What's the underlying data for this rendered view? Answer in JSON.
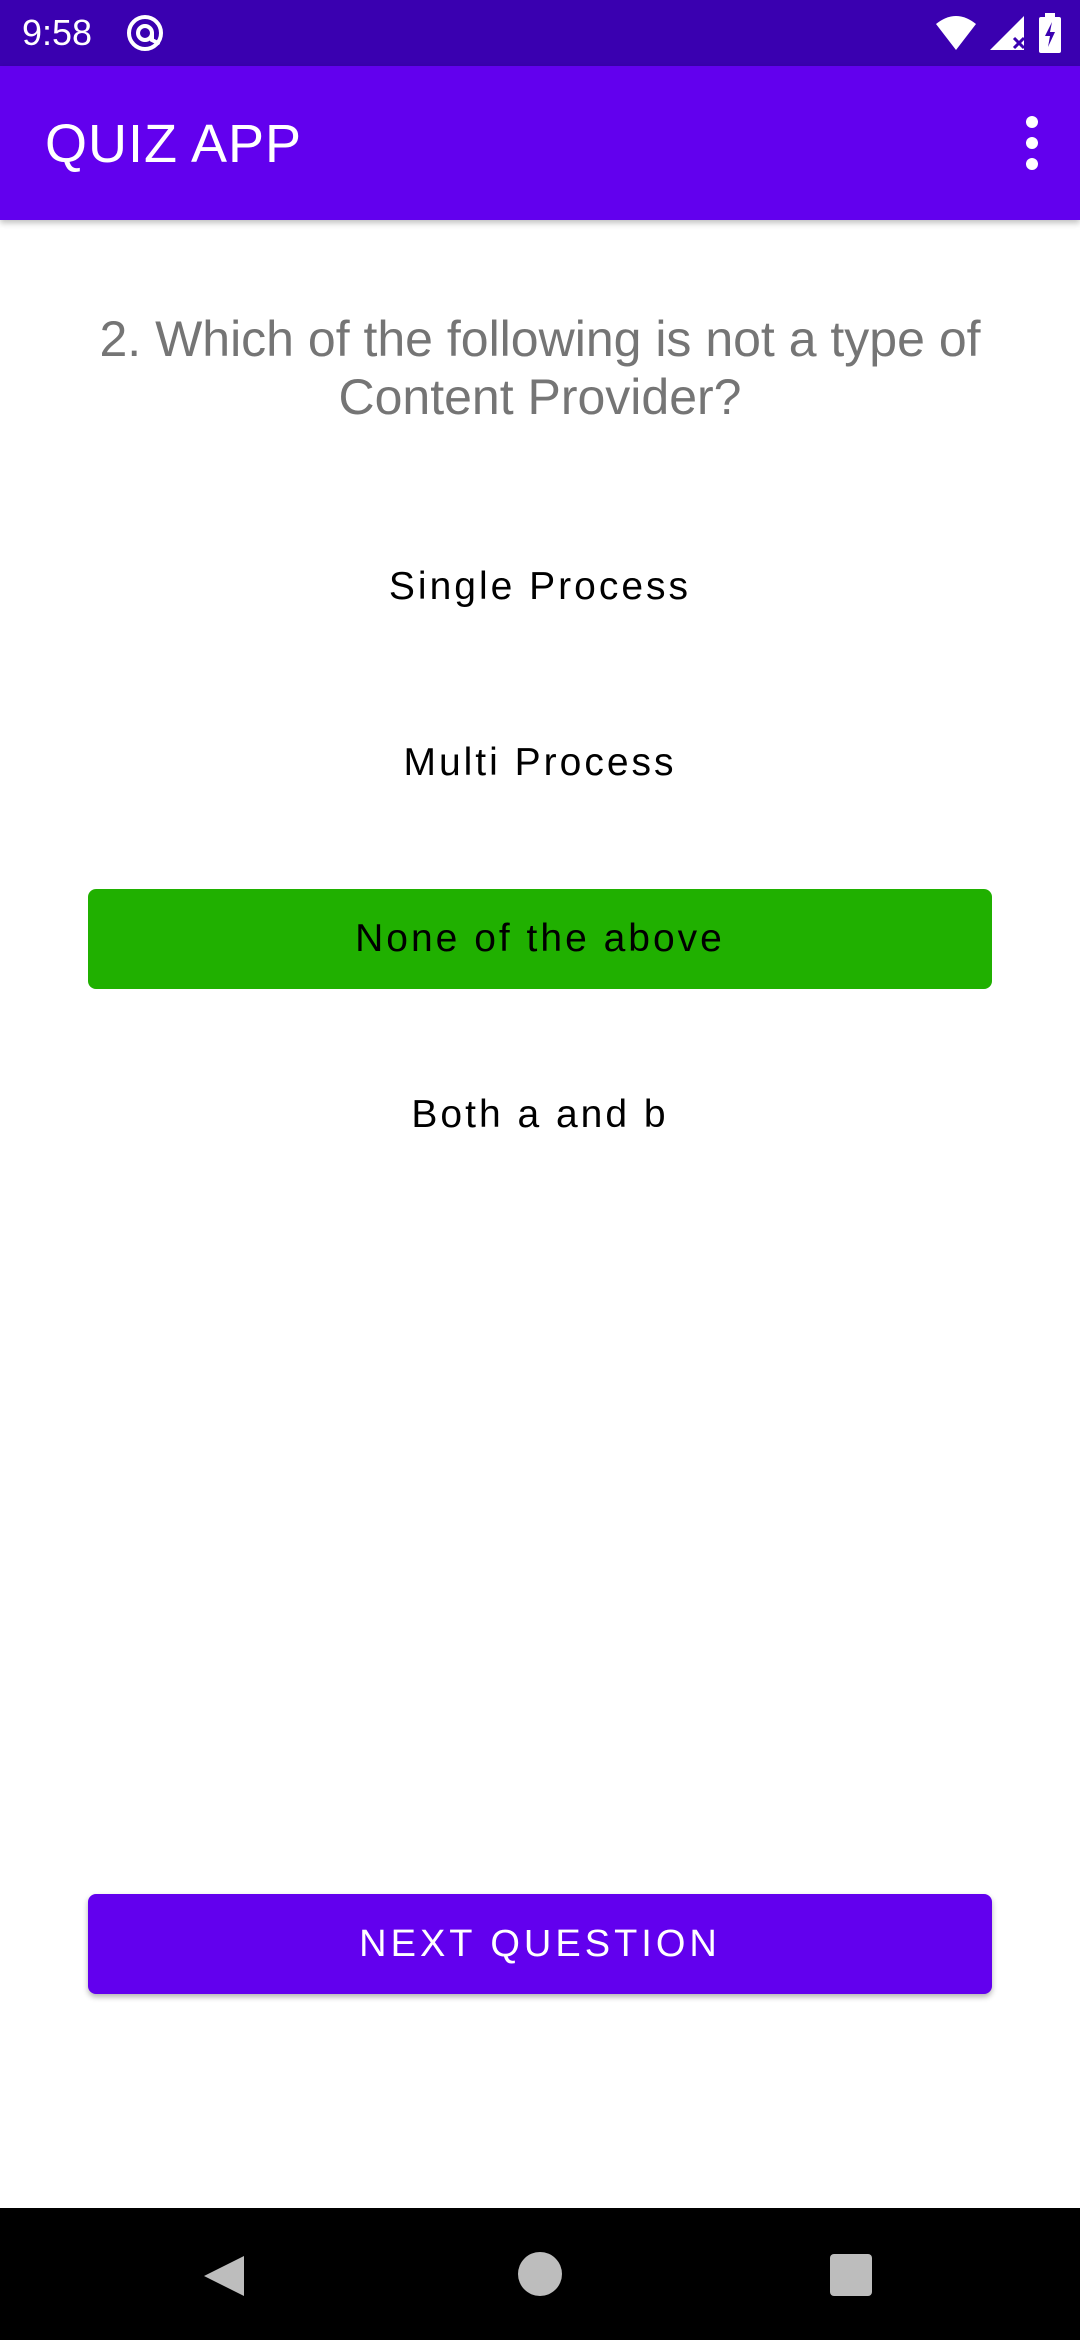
{
  "status_bar": {
    "time": "9:58"
  },
  "app_bar": {
    "title": "QUIZ APP"
  },
  "quiz": {
    "question": "2. Which of the following is not a type of Content Provider?",
    "options": [
      {
        "label": "Single Process",
        "selected": false
      },
      {
        "label": "Multi Process",
        "selected": false
      },
      {
        "label": "None of the above",
        "selected": true
      },
      {
        "label": "Both a and b",
        "selected": false
      }
    ],
    "next_label": "NEXT QUESTION"
  },
  "colors": {
    "status_bar": "#3a00b0",
    "app_bar": "#6200ee",
    "selected_option": "#20b000",
    "question_text": "#757575"
  },
  "icons": {
    "status_left": "at-sign-icon",
    "status_right": [
      "wifi-icon",
      "signal-icon",
      "battery-charging-icon"
    ],
    "app_bar_right": "more-vert-icon",
    "nav": [
      "back-icon",
      "home-icon",
      "recents-icon"
    ]
  }
}
